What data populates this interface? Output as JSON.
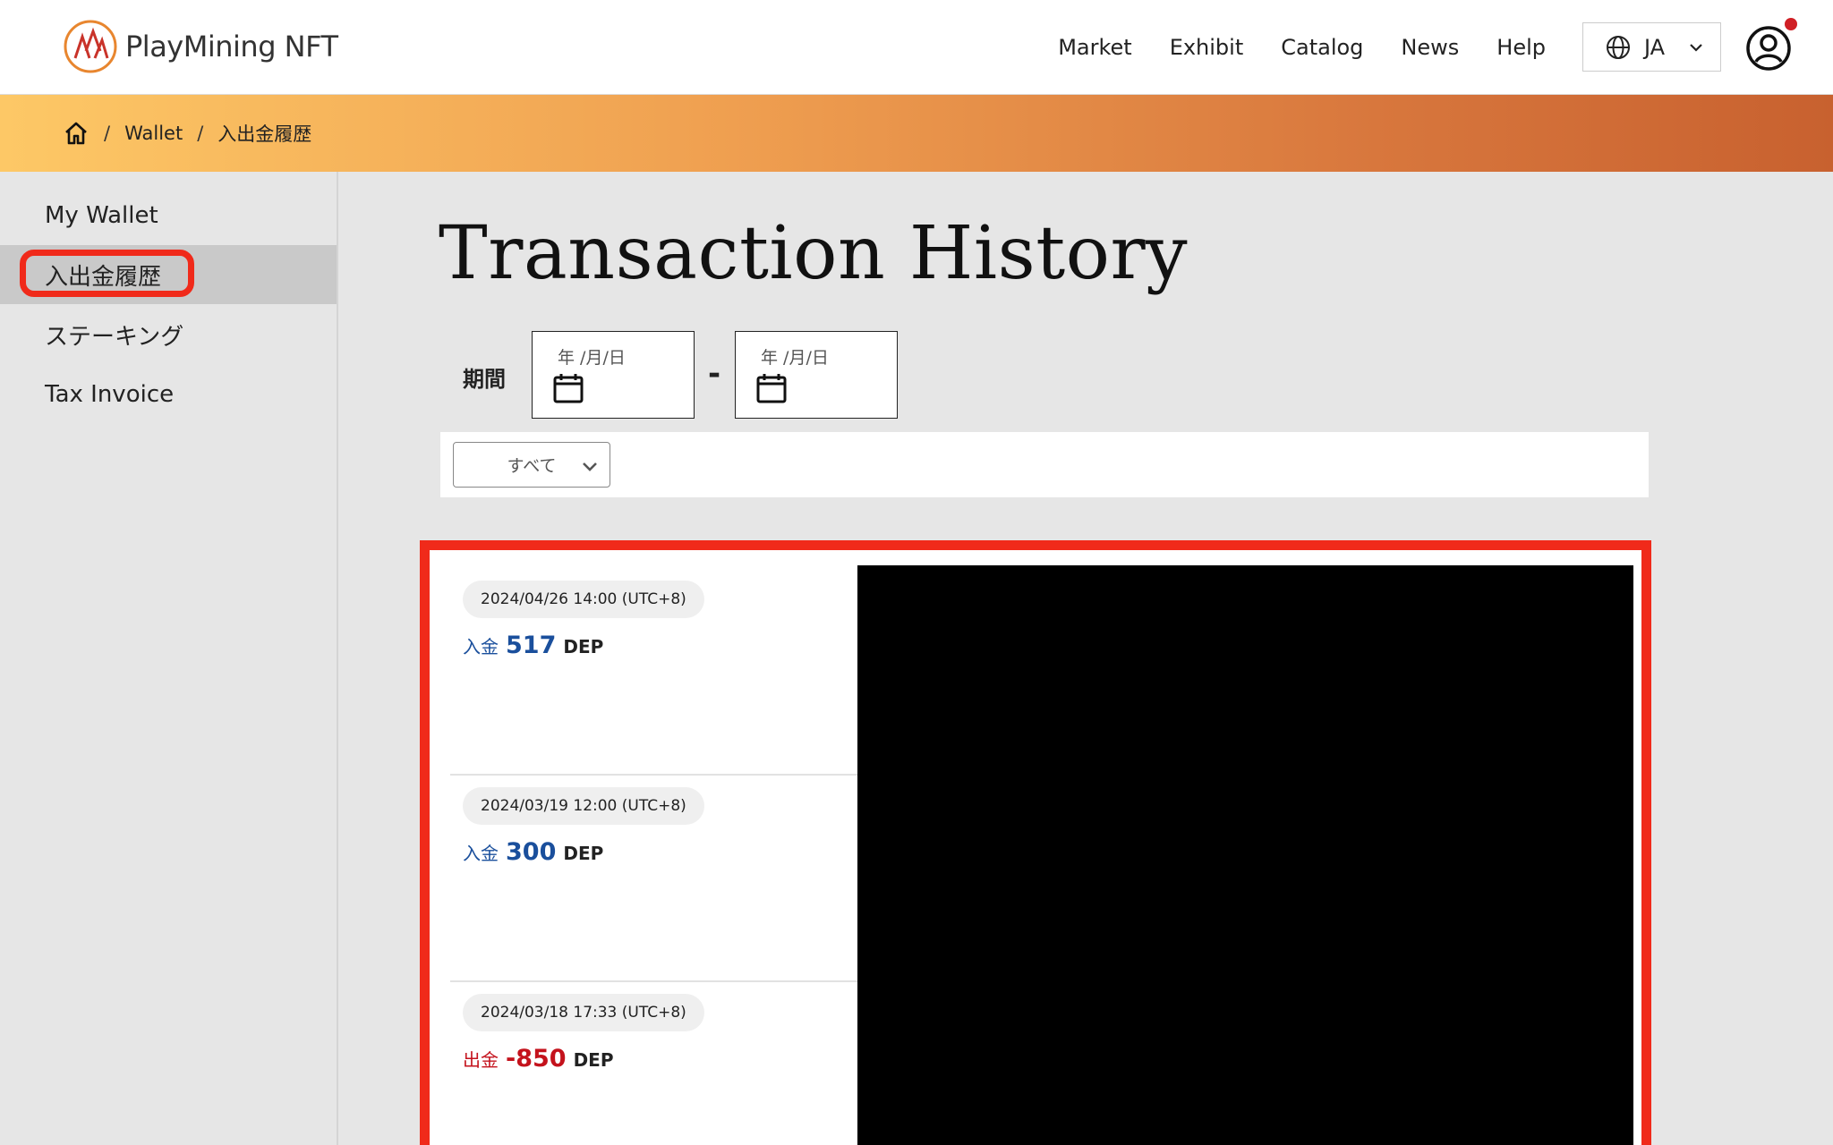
{
  "header": {
    "logo_text": "PlayMining NFT",
    "nav": [
      "Market",
      "Exhibit",
      "Catalog",
      "News",
      "Help"
    ],
    "language": "JA"
  },
  "breadcrumb": {
    "items": [
      "Wallet",
      "入出金履歴"
    ]
  },
  "sidebar": {
    "items": [
      "My Wallet",
      "入出金履歴",
      "ステーキング",
      "Tax Invoice"
    ],
    "active_index": 1
  },
  "main": {
    "title": "Transaction History",
    "period_label": "期間",
    "date_placeholder": "年 /月/日",
    "range_separator": "-",
    "filter_selected": "すべて"
  },
  "transactions": [
    {
      "datetime": "2024/04/26 14:00 (UTC+8)",
      "kind": "入金",
      "amount": "517",
      "unit": "DEP",
      "color": "#1a4f9c"
    },
    {
      "datetime": "2024/03/19 12:00 (UTC+8)",
      "kind": "入金",
      "amount": "300",
      "unit": "DEP",
      "color": "#1a4f9c"
    },
    {
      "datetime": "2024/03/18 17:33 (UTC+8)",
      "kind": "出金",
      "amount": "-850",
      "unit": "DEP",
      "color": "#c4121c"
    }
  ],
  "colors": {
    "deposit": "#1a4f9c",
    "withdrawal": "#c4121c",
    "highlight": "#f02a1a"
  }
}
